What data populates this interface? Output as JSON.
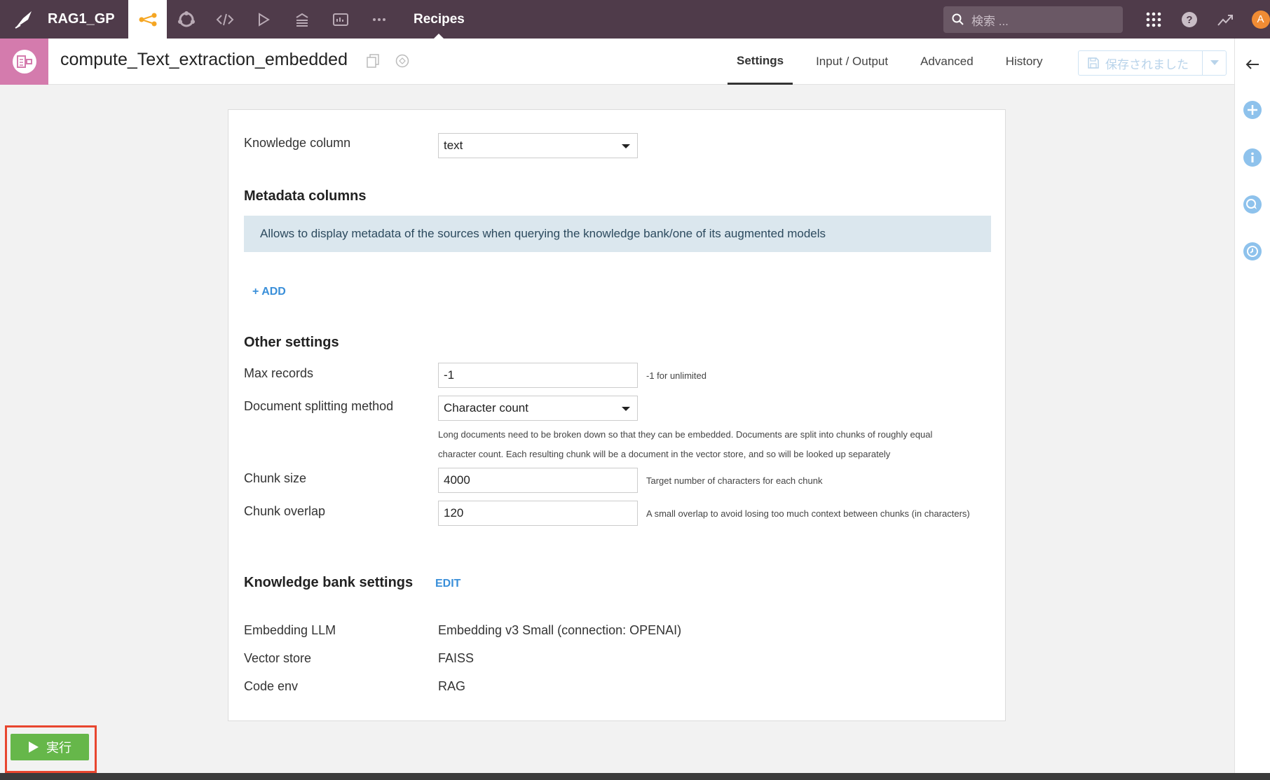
{
  "topnav": {
    "project": "RAG1_GP",
    "title": "Recipes",
    "search_placeholder": "検索 ...",
    "avatar_letter": "A",
    "accent": "#f5a623",
    "bg": "#4f3b4a"
  },
  "header": {
    "recipe_name": "compute_Text_extraction_embedded",
    "tabs": [
      "Settings",
      "Input / Output",
      "Advanced",
      "History"
    ],
    "active_tab": "Settings",
    "save_label": "保存されました"
  },
  "form": {
    "knowledge_column_label": "Knowledge column",
    "knowledge_column_value": "text",
    "metadata_title": "Metadata columns",
    "metadata_info": "Allows to display metadata of the sources when querying the knowledge bank/one of its augmented models",
    "add_label": "+ ADD",
    "other_title": "Other settings",
    "max_records_label": "Max records",
    "max_records_value": "-1",
    "max_records_hint": "-1 for unlimited",
    "splitting_label": "Document splitting method",
    "splitting_value": "Character count",
    "splitting_hint_1": "Long documents need to be broken down so that they can be embedded. Documents are split into chunks of roughly equal",
    "splitting_hint_2": "character count. Each resulting chunk will be a document in the vector store, and so will be looked up separately",
    "chunk_size_label": "Chunk size",
    "chunk_size_value": "4000",
    "chunk_size_hint": "Target number of characters for each chunk",
    "chunk_overlap_label": "Chunk overlap",
    "chunk_overlap_value": "120",
    "chunk_overlap_hint": "A small overlap to avoid losing too much context between chunks (in characters)",
    "kb_title": "Knowledge bank settings",
    "edit_label": "EDIT",
    "embedding_label": "Embedding LLM",
    "embedding_value": "Embedding v3 Small (connection: OPENAI)",
    "vector_label": "Vector store",
    "vector_value": "FAISS",
    "codeenv_label": "Code env",
    "codeenv_value": "RAG"
  },
  "run": {
    "label": "実行",
    "color": "#66b74a"
  }
}
